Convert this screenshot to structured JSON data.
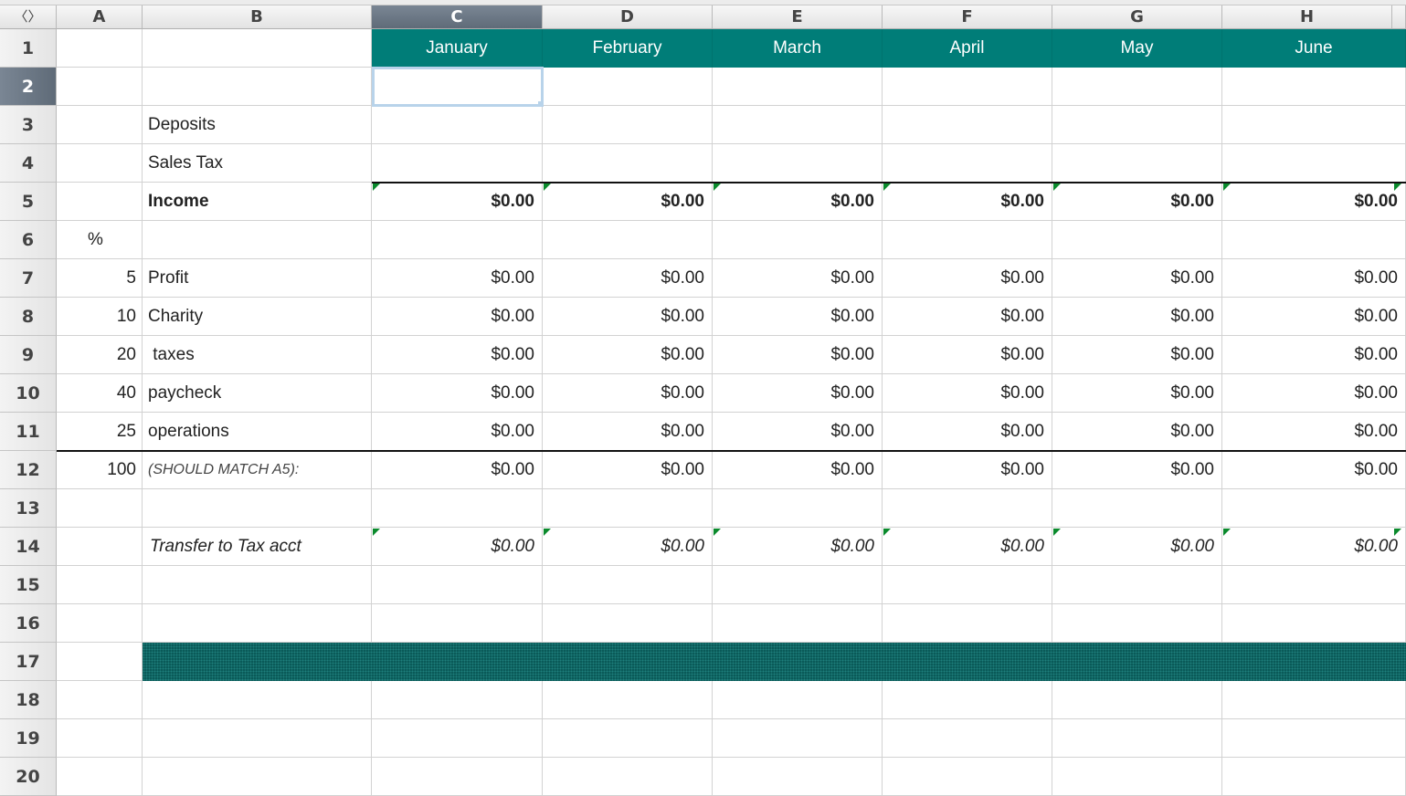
{
  "grid": {
    "corner_icon": "sort-arrows-icon",
    "columns": [
      "A",
      "B",
      "C",
      "D",
      "E",
      "F",
      "G",
      "H"
    ],
    "rows": [
      "1",
      "2",
      "3",
      "4",
      "5",
      "6",
      "7",
      "8",
      "9",
      "10",
      "11",
      "12",
      "13",
      "14",
      "15",
      "16",
      "17",
      "18",
      "19",
      "20"
    ],
    "selected_cell": "C2"
  },
  "months": [
    "January",
    "February",
    "March",
    "April",
    "May",
    "June"
  ],
  "labels": {
    "deposits": "Deposits",
    "sales_tax": "Sales Tax",
    "income": "Income",
    "percent_header": "%",
    "should_match": "(SHOULD MATCH A5):",
    "transfer": "Transfer to Tax acct"
  },
  "income_values": [
    "$0.00",
    "$0.00",
    "$0.00",
    "$0.00",
    "$0.00",
    "$0.00"
  ],
  "allocations": [
    {
      "pct": "5",
      "label": "Profit",
      "values": [
        "$0.00",
        "$0.00",
        "$0.00",
        "$0.00",
        "$0.00",
        "$0.00"
      ]
    },
    {
      "pct": "10",
      "label": "Charity",
      "values": [
        "$0.00",
        "$0.00",
        "$0.00",
        "$0.00",
        "$0.00",
        "$0.00"
      ]
    },
    {
      "pct": "20",
      "label": " taxes",
      "values": [
        "$0.00",
        "$0.00",
        "$0.00",
        "$0.00",
        "$0.00",
        "$0.00"
      ]
    },
    {
      "pct": "40",
      "label": "paycheck",
      "values": [
        "$0.00",
        "$0.00",
        "$0.00",
        "$0.00",
        "$0.00",
        "$0.00"
      ]
    },
    {
      "pct": "25",
      "label": "operations",
      "values": [
        "$0.00",
        "$0.00",
        "$0.00",
        "$0.00",
        "$0.00",
        "$0.00"
      ]
    }
  ],
  "total": {
    "pct": "100",
    "values": [
      "$0.00",
      "$0.00",
      "$0.00",
      "$0.00",
      "$0.00",
      "$0.00"
    ]
  },
  "transfer_values": [
    "$0.00",
    "$0.00",
    "$0.00",
    "$0.00",
    "$0.00",
    "$0.00"
  ],
  "colors": {
    "header_teal": "#007d78",
    "band_teal": "#0a5a58",
    "comment_marker": "#0a8a2c",
    "selection": "#b8d3ea"
  }
}
